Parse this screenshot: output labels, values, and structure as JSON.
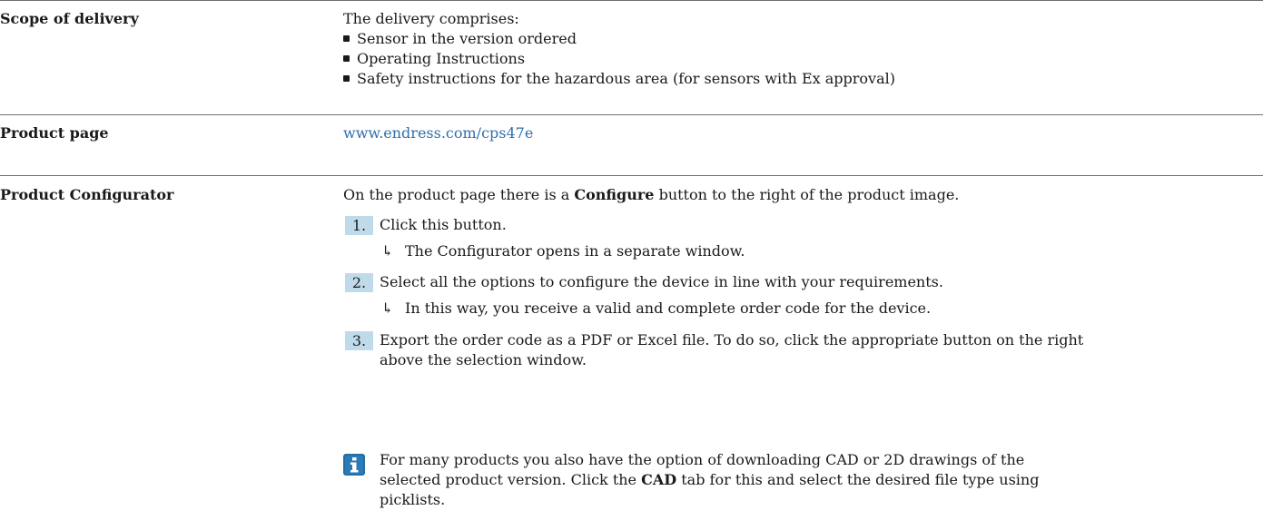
{
  "scope": {
    "label": "Scope of delivery",
    "intro": "The delivery comprises:",
    "items": [
      "Sensor in the version ordered",
      "Operating Instructions",
      "Safety instructions for the hazardous area (for sensors with Ex approval)"
    ]
  },
  "product_page": {
    "label": "Product page",
    "link": "www.endress.com/cps47e"
  },
  "configurator": {
    "label": "Product Configurator",
    "intro_before": "On the product page there is a ",
    "intro_bold": "Configure",
    "intro_after": " button to the right of the product image.",
    "steps": [
      {
        "num": "1.",
        "text": "Click this button.",
        "result": "The Configurator opens in a separate window."
      },
      {
        "num": "2.",
        "text": "Select all the options to configure the device in line with your requirements.",
        "result": "In this way, you receive a valid and complete order code for the device."
      },
      {
        "num": "3.",
        "text_line1": "Export the order code as a PDF or Excel file. To do so, click the appropriate button on the right",
        "text_line2": "above the selection window."
      }
    ],
    "note": {
      "line1": "For many products you also have the option of downloading CAD or 2D drawings of the",
      "line2_before": "selected product version. Click the ",
      "line2_bold": "CAD",
      "line2_after": " tab for this and select the desired file type using",
      "line3": "picklists."
    }
  }
}
